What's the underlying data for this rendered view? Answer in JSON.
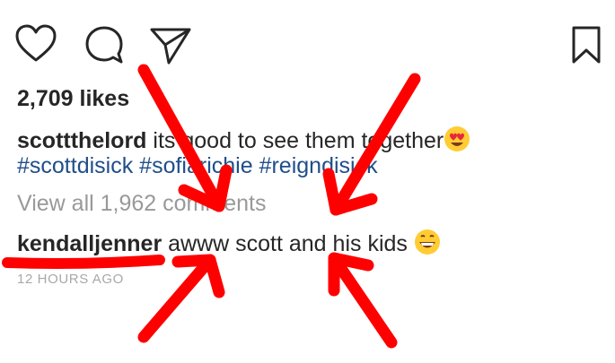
{
  "icons": {
    "like": "heart-icon",
    "comment": "comment-bubble-icon",
    "share": "paper-plane-icon",
    "save": "bookmark-icon"
  },
  "likes_text": "2,709 likes",
  "caption": {
    "username": "scottthelord",
    "text_part1": "its good to see them together",
    "hashtags": [
      "#scottdisick",
      "#sofiarichie",
      "#reigndisick"
    ]
  },
  "view_comments": "View all 1,962 comments",
  "comment": {
    "username": "kendalljenner",
    "text": "awww scott and his kids"
  },
  "timestamp": "12 HOURS AGO",
  "colors": {
    "text": "#262626",
    "hashtag": "#1f4e8a",
    "muted": "#999999",
    "annotation": "#ff0000"
  }
}
